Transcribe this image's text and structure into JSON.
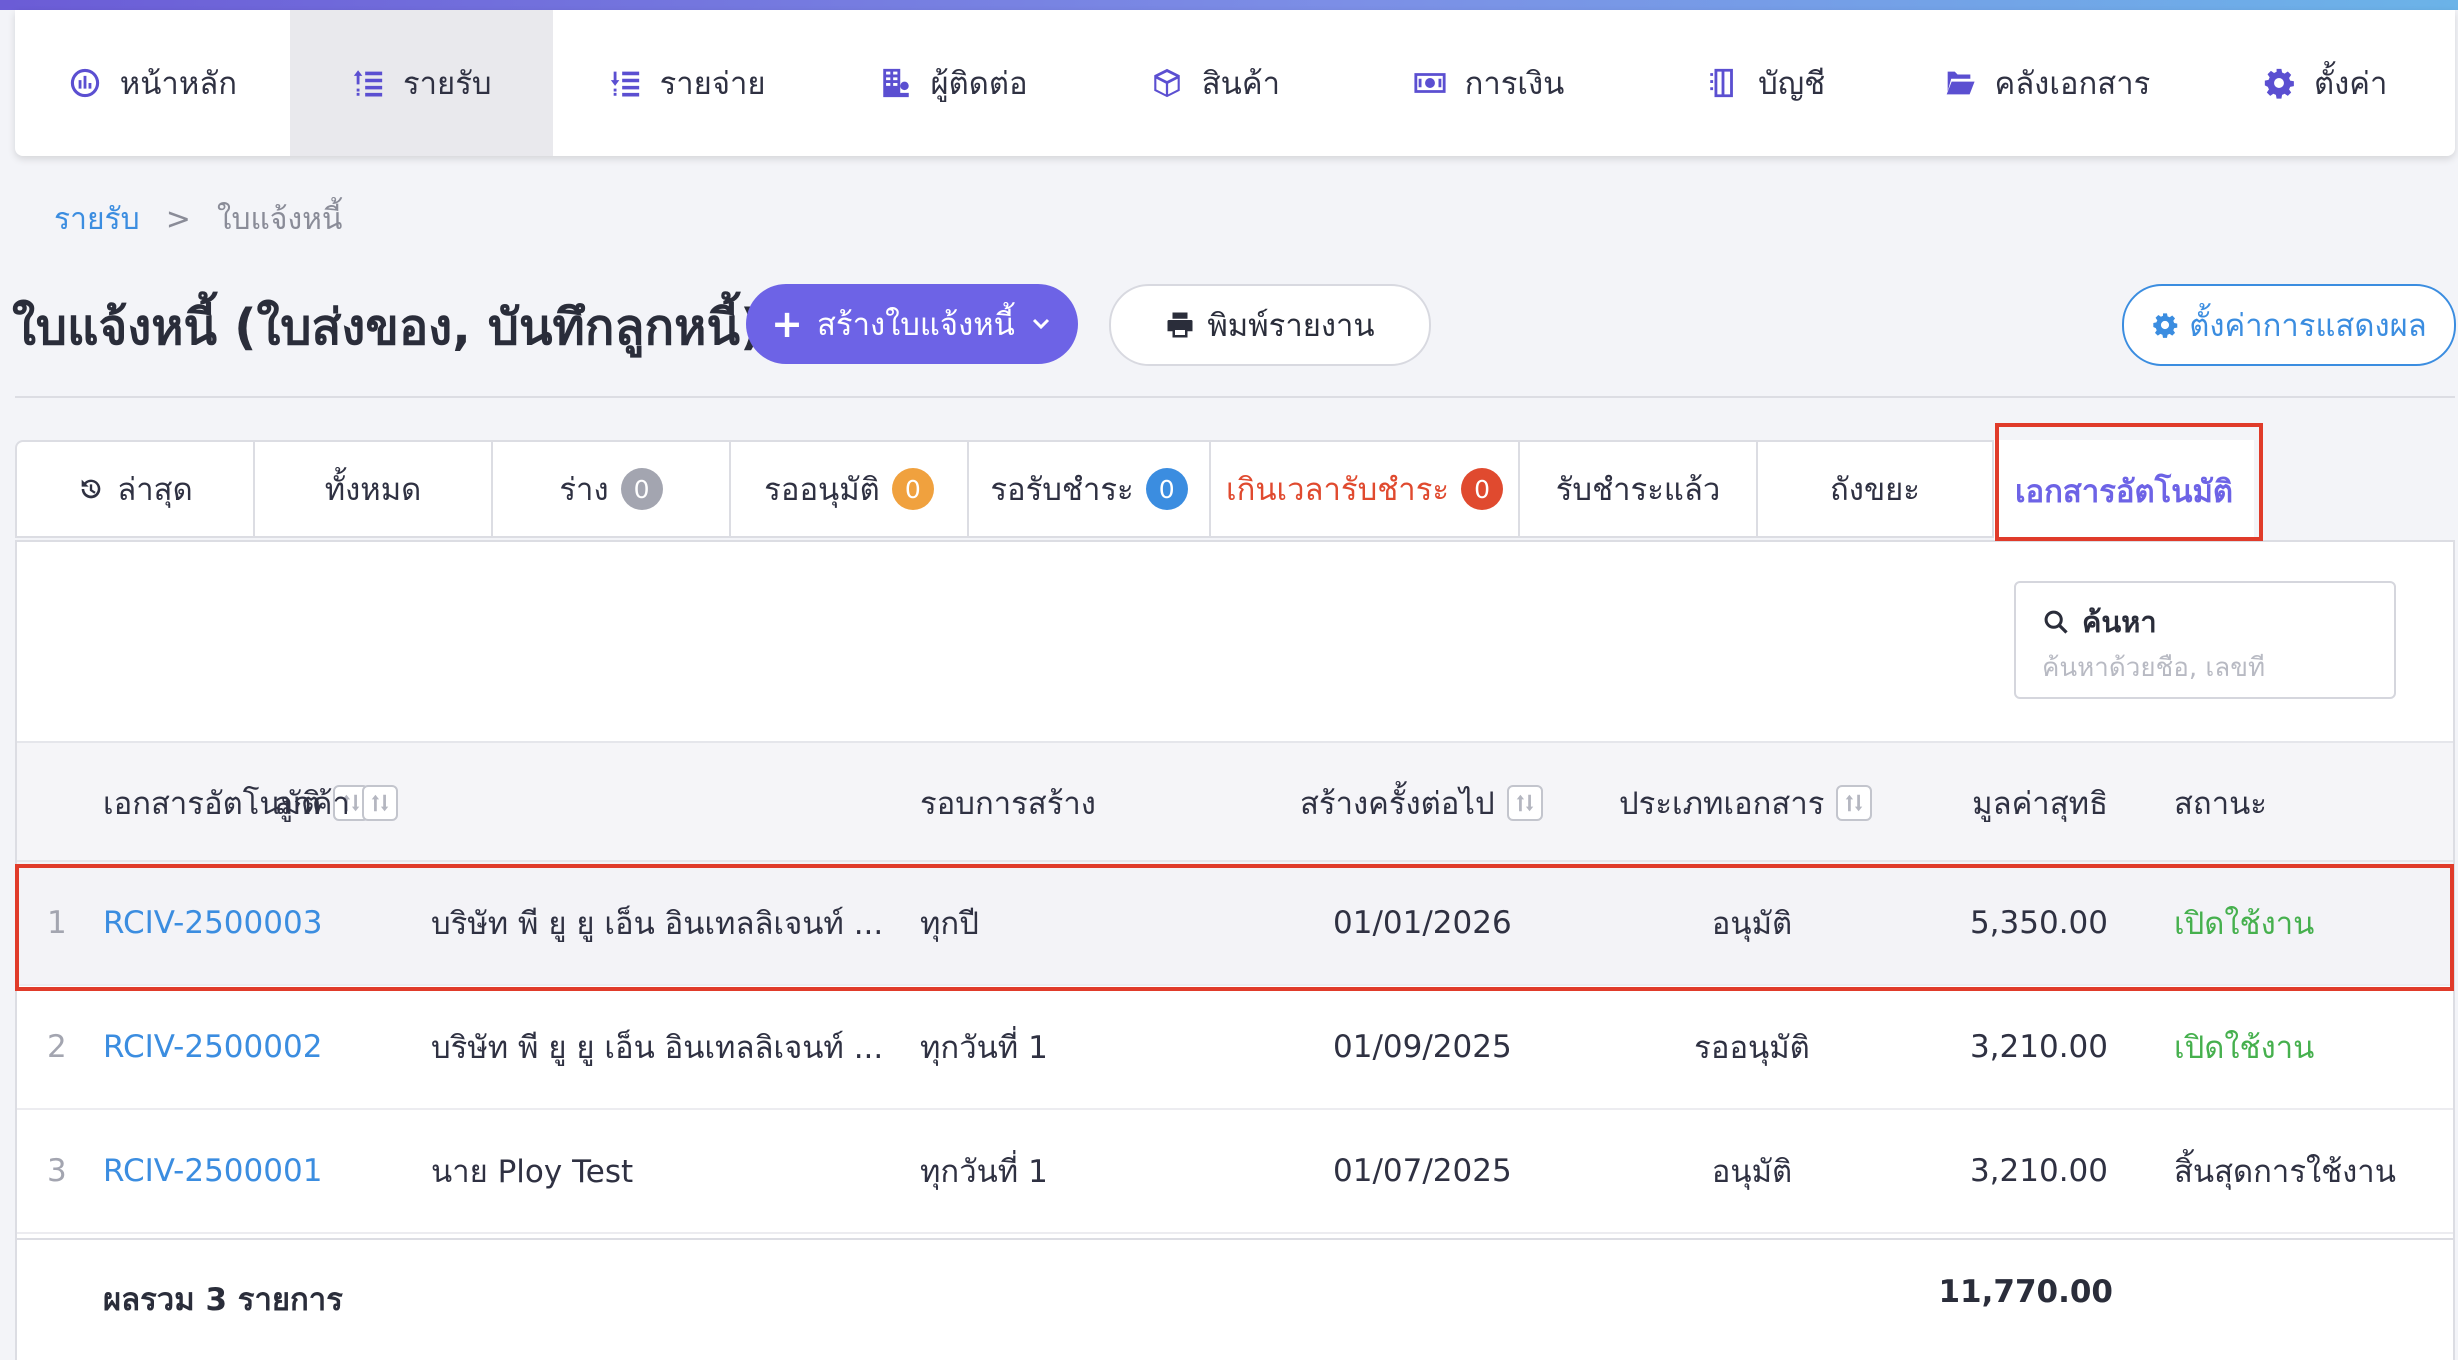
{
  "nav": {
    "items": [
      {
        "label": "หน้าหลัก",
        "icon": "dashboard-icon"
      },
      {
        "label": "รายรับ",
        "icon": "income-icon"
      },
      {
        "label": "รายจ่าย",
        "icon": "expense-icon"
      },
      {
        "label": "ผู้ติดต่อ",
        "icon": "contacts-icon"
      },
      {
        "label": "สินค้า",
        "icon": "box-icon"
      },
      {
        "label": "การเงิน",
        "icon": "money-icon"
      },
      {
        "label": "บัญชี",
        "icon": "ledger-icon"
      },
      {
        "label": "คลังเอกสาร",
        "icon": "folder-icon"
      },
      {
        "label": "ตั้งค่า",
        "icon": "gear-icon"
      }
    ],
    "active_index": 1
  },
  "breadcrumb": {
    "parent": "รายรับ",
    "separator": ">",
    "current": "ใบแจ้งหนี้"
  },
  "page": {
    "title": "ใบแจ้งหนี้ (ใบส่งของ, บันทึกลูกหนี้)"
  },
  "toolbar": {
    "create_label": "สร้างใบแจ้งหนี้",
    "print_label": "พิมพ์รายงาน",
    "display_settings_label": "ตั้งค่าการแสดงผล"
  },
  "tabs": [
    {
      "label": "ล่าสุด",
      "icon": "history-icon"
    },
    {
      "label": "ทั้งหมด"
    },
    {
      "label": "ร่าง",
      "count": "0",
      "badge_color": "#a3a5b0"
    },
    {
      "label": "รออนุมัติ",
      "count": "0",
      "badge_color": "#f0a13e"
    },
    {
      "label": "รอรับชำระ",
      "count": "0",
      "badge_color": "#3b8de0"
    },
    {
      "label": "เกินเวลารับชำระ",
      "count": "0",
      "badge_color": "#e04a2f"
    },
    {
      "label": "รับชำระแล้ว"
    },
    {
      "label": "ถังขยะ"
    },
    {
      "label": "เอกสารอัตโนมัติ"
    }
  ],
  "active_tab_index": 8,
  "search": {
    "label": "ค้นหา",
    "placeholder": "ค้นหาด้วยชื่อ, เลขที่"
  },
  "table": {
    "columns": {
      "doc": "เอกสารอัตโนมัติ",
      "customer": "ลูกค้า",
      "cycle": "รอบการสร้าง",
      "next": "สร้างครั้งต่อไป",
      "type": "ประเภทเอกสาร",
      "amount": "มูลค่าสุทธิ",
      "status": "สถานะ"
    },
    "rows": [
      {
        "no": "1",
        "doc": "RCIV-2500003",
        "customer": "บริษัท พี ยู ยู เอ็น อินเทลลิเจนท์ ...",
        "cycle": "ทุกปี",
        "next": "01/01/2026",
        "type": "อนุมัติ",
        "amount": "5,350.00",
        "status": "เปิดใช้งาน"
      },
      {
        "no": "2",
        "doc": "RCIV-2500002",
        "customer": "บริษัท พี ยู ยู เอ็น อินเทลลิเจนท์ ...",
        "cycle": "ทุกวันที่ 1",
        "next": "01/09/2025",
        "type": "รออนุมัติ",
        "amount": "3,210.00",
        "status": "เปิดใช้งาน"
      },
      {
        "no": "3",
        "doc": "RCIV-2500001",
        "customer": "นาย Ploy Test",
        "cycle": "ทุกวันที่ 1",
        "next": "01/07/2025",
        "type": "อนุมัติ",
        "amount": "3,210.00",
        "status": "สิ้นสุดการใช้งาน"
      }
    ],
    "total_label": "ผลรวม 3 รายการ",
    "total_value": "11,770.00"
  },
  "colors": {
    "accent": "#6d63e6",
    "link": "#3b8de0",
    "active_status": "#46b04e",
    "highlight": "#e03b2a",
    "overdue": "#e04a2f"
  }
}
